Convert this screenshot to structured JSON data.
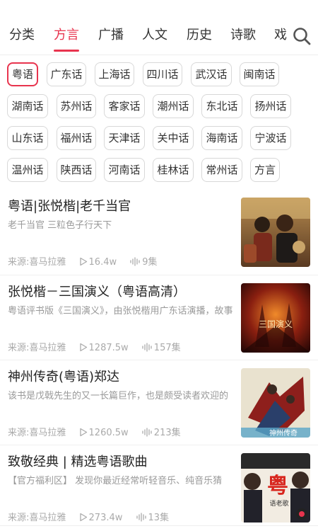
{
  "tabs": [
    {
      "label": "分类",
      "active": false
    },
    {
      "label": "方言",
      "active": true
    },
    {
      "label": "广播",
      "active": false
    },
    {
      "label": "人文",
      "active": false
    },
    {
      "label": "历史",
      "active": false
    },
    {
      "label": "诗歌",
      "active": false
    },
    {
      "label": "戏",
      "active": false
    }
  ],
  "search": {
    "icon": "search-icon"
  },
  "accent_color": "#e8344e",
  "dialects": [
    {
      "label": "粤语",
      "selected": true
    },
    {
      "label": "广东话"
    },
    {
      "label": "上海话"
    },
    {
      "label": "四川话"
    },
    {
      "label": "武汉话"
    },
    {
      "label": "闽南话"
    },
    {
      "label": "湖南话"
    },
    {
      "label": "苏州话"
    },
    {
      "label": "客家话"
    },
    {
      "label": "潮州话"
    },
    {
      "label": "东北话"
    },
    {
      "label": "扬州话"
    },
    {
      "label": "山东话"
    },
    {
      "label": "福州话"
    },
    {
      "label": "天津话"
    },
    {
      "label": "关中话"
    },
    {
      "label": "海南话"
    },
    {
      "label": "宁波话"
    },
    {
      "label": "温州话"
    },
    {
      "label": "陕西话"
    },
    {
      "label": "河南话"
    },
    {
      "label": "桂林话"
    },
    {
      "label": "常州话"
    },
    {
      "label": "方言"
    }
  ],
  "albums": [
    {
      "title": "粤语|张悦楷|老千当官",
      "desc": "老千当官 三粒色子行天下",
      "source": "来源:喜马拉雅",
      "plays": "16.4w",
      "episodes": "9集"
    },
    {
      "title": "张悦楷－三国演义（粤语高清）",
      "desc": "粤语评书版《三国演义》，由张悦楷用广东话演播，故事",
      "source": "来源:喜马拉雅",
      "plays": "1287.5w",
      "episodes": "157集",
      "cover_text": "三国演义"
    },
    {
      "title": "神州传奇(粤语)郑达",
      "desc": "该书是戊戟先生的又一长篇巨作，也是颇受读者欢迎的",
      "source": "来源:喜马拉雅",
      "plays": "1260.5w",
      "episodes": "213集",
      "cover_text": "神州传奇"
    },
    {
      "title": "致敬经典 | 精选粤语歌曲",
      "desc": "【官方福利区】 发现你最近经常听轻音乐、纯音乐猜",
      "source": "来源:喜马拉雅",
      "plays": "273.4w",
      "episodes": "13集",
      "cover_text": "粤",
      "cover_text2": "语老歌"
    }
  ]
}
